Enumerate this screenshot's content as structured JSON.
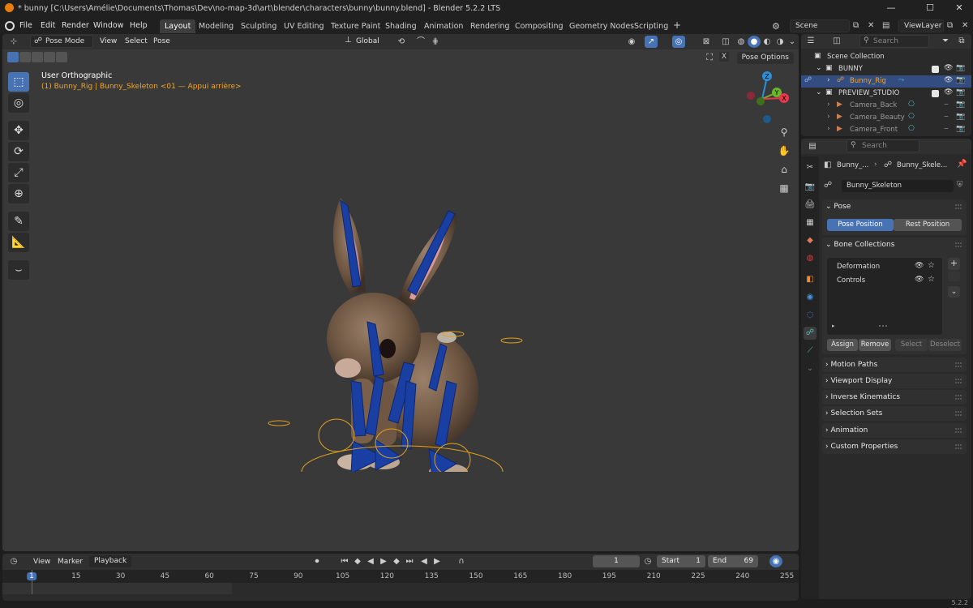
{
  "window": {
    "title": "* bunny [C:\\Users\\Amélie\\Documents\\Thomas\\Dev\\no-map-3d\\art\\blender\\characters\\bunny\\bunny.blend] - Blender 5.2.2 LTS",
    "minimize": "—",
    "maximize": "☐",
    "close": "✕"
  },
  "menu": {
    "items": [
      "File",
      "Edit",
      "Render",
      "Window",
      "Help"
    ]
  },
  "workspaces": {
    "tabs": [
      "Layout",
      "Modeling",
      "Sculpting",
      "UV Editing",
      "Texture Paint",
      "Shading",
      "Animation",
      "Rendering",
      "Compositing",
      "Geometry Nodes",
      "Scripting"
    ],
    "active": "Layout",
    "add": "+"
  },
  "scene": {
    "name": "Scene",
    "view_layer": "ViewLayer"
  },
  "viewport_header": {
    "mode": "Pose Mode",
    "menus": [
      "View",
      "Select",
      "Pose"
    ],
    "orientation": "Global"
  },
  "viewport": {
    "view_name": "User Orthographic",
    "object_info": "(1) Bunny_Rig | Bunny_Skeleton <01 — Appui arrière>",
    "pose_options": "Pose Options",
    "gizmo": {
      "x": "X",
      "y": "Y",
      "z": "Z"
    }
  },
  "timeline": {
    "menus": [
      "View",
      "Marker"
    ],
    "playback": "Playback",
    "current_frame": "1",
    "start_label": "Start",
    "start": "1",
    "end_label": "End",
    "end": "69",
    "ticks": [
      "1",
      "15",
      "30",
      "45",
      "60",
      "75",
      "90",
      "105",
      "120",
      "135",
      "150",
      "165",
      "180",
      "195",
      "210",
      "225",
      "240",
      "255"
    ]
  },
  "status": {
    "version": "5.2.2"
  },
  "outliner": {
    "search_placeholder": "Search",
    "rows": [
      {
        "label": "Scene Collection",
        "indent": 0
      },
      {
        "label": "BUNNY",
        "indent": 1
      },
      {
        "label": "Bunny_Rig",
        "indent": 2
      },
      {
        "label": "PREVIEW_STUDIO",
        "indent": 1
      },
      {
        "label": "Camera_Back",
        "indent": 2
      },
      {
        "label": "Camera_Beauty",
        "indent": 2
      },
      {
        "label": "Camera_Front",
        "indent": 2
      }
    ]
  },
  "properties": {
    "search_placeholder": "Search",
    "breadcrumb_object": "Bunny_...",
    "breadcrumb_data": "Bunny_Skele...",
    "data_name": "Bunny_Skeleton",
    "pose_panel": {
      "title": "Pose",
      "pose_position": "Pose Position",
      "rest_position": "Rest Position"
    },
    "bone_collections": {
      "title": "Bone Collections",
      "items": [
        "Deformation",
        "Controls"
      ],
      "assign": "Assign",
      "remove": "Remove",
      "select": "Select",
      "deselect": "Deselect"
    },
    "collapsed_panels": [
      "Motion Paths",
      "Viewport Display",
      "Inverse Kinematics",
      "Selection Sets",
      "Animation",
      "Custom Properties"
    ]
  },
  "colors": {
    "accent": "#4772b3",
    "selection_orange": "#f5a623",
    "bone_blue": "#1a3fa3",
    "axis_x": "#e8394a",
    "axis_y": "#6ab82a",
    "axis_z": "#2c8fd8"
  }
}
